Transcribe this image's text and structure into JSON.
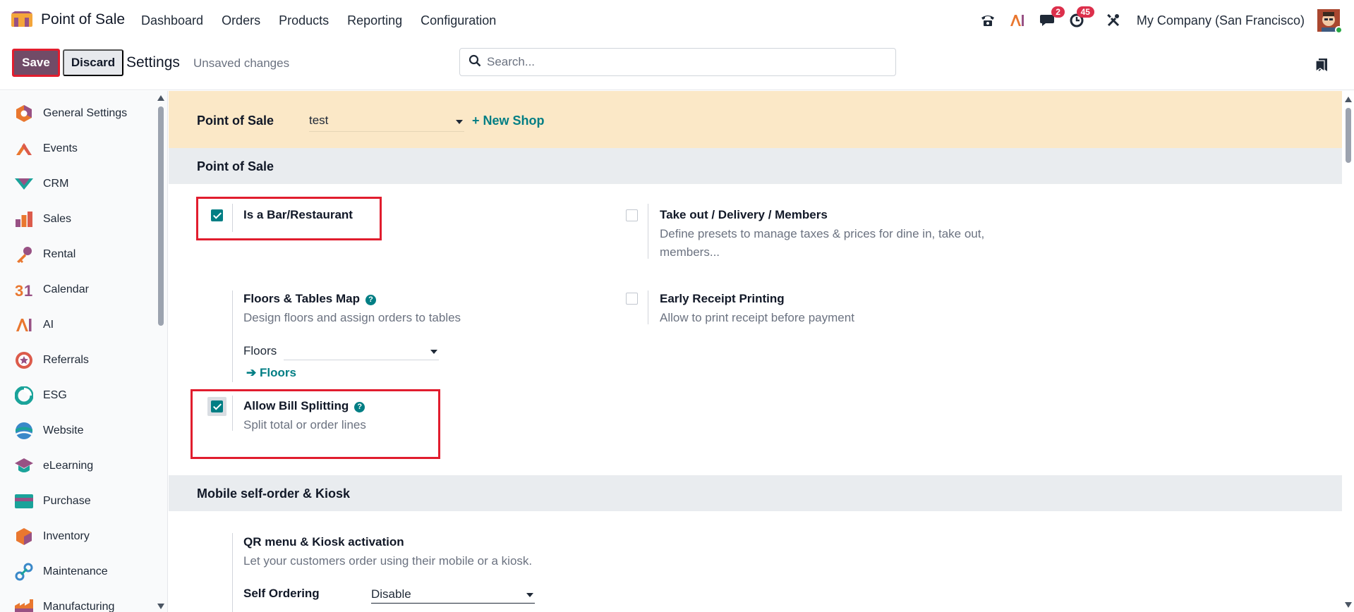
{
  "navbar": {
    "app_name": "Point of Sale",
    "menu": [
      "Dashboard",
      "Orders",
      "Products",
      "Reporting",
      "Configuration"
    ],
    "messages_badge": "2",
    "activities_badge": "45",
    "company": "My Company (San Francisco)"
  },
  "controlbar": {
    "save_label": "Save",
    "discard_label": "Discard",
    "title": "Settings",
    "status": "Unsaved changes",
    "search_placeholder": "Search..."
  },
  "sidebar": {
    "items": [
      {
        "label": "General Settings",
        "icon": "general-settings-icon"
      },
      {
        "label": "Events",
        "icon": "events-icon"
      },
      {
        "label": "CRM",
        "icon": "crm-icon"
      },
      {
        "label": "Sales",
        "icon": "sales-icon"
      },
      {
        "label": "Rental",
        "icon": "rental-icon"
      },
      {
        "label": "Calendar",
        "icon": "calendar-icon"
      },
      {
        "label": "AI",
        "icon": "ai-icon"
      },
      {
        "label": "Referrals",
        "icon": "referrals-icon"
      },
      {
        "label": "ESG",
        "icon": "esg-icon"
      },
      {
        "label": "Website",
        "icon": "website-icon"
      },
      {
        "label": "eLearning",
        "icon": "elearning-icon"
      },
      {
        "label": "Purchase",
        "icon": "purchase-icon"
      },
      {
        "label": "Inventory",
        "icon": "inventory-icon"
      },
      {
        "label": "Maintenance",
        "icon": "maintenance-icon"
      },
      {
        "label": "Manufacturing",
        "icon": "manufacturing-icon"
      }
    ]
  },
  "shopbar": {
    "label": "Point of Sale",
    "selected_shop": "test",
    "new_shop": "+ New Shop"
  },
  "pos_section": {
    "heading": "Point of Sale",
    "bar_restaurant": {
      "title": "Is a Bar/Restaurant",
      "checked": true
    },
    "takeout": {
      "title": "Take out / Delivery / Members",
      "desc_line1": "Define presets to manage taxes & prices for dine in, take out,",
      "desc_line2": "members...",
      "checked": false
    },
    "floors": {
      "title": "Floors & Tables Map",
      "desc": "Design floors and assign orders to tables",
      "field_label": "Floors",
      "link": "Floors"
    },
    "early_receipt": {
      "title": "Early Receipt Printing",
      "desc": "Allow to print receipt before payment",
      "checked": false
    },
    "bill_split": {
      "title": "Allow Bill Splitting",
      "desc": "Split total or order lines",
      "checked": true
    }
  },
  "kiosk_section": {
    "heading": "Mobile self-order & Kiosk",
    "qr": {
      "title": "QR menu & Kiosk activation",
      "desc": "Let your customers order using their mobile or a kiosk."
    },
    "self_ordering_label": "Self Ordering",
    "self_ordering_value": "Disable"
  },
  "colors": {
    "brand": "#714b67",
    "accent": "#017e84",
    "highlight": "#e11d2e",
    "shopbar_bg": "#fbe8c7"
  }
}
